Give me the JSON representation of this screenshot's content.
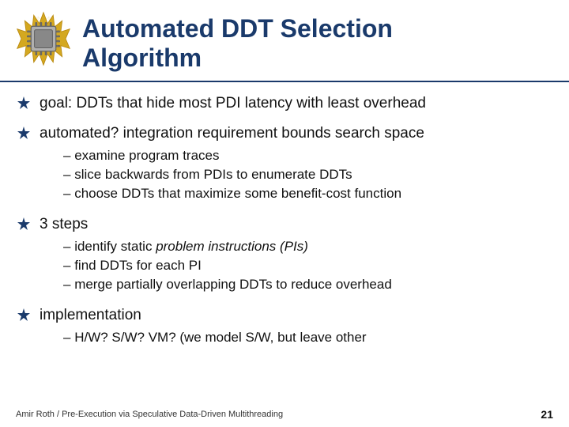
{
  "header": {
    "title_line1": "Automated DDT Selection",
    "title_line2": "Algorithm"
  },
  "bullets": [
    {
      "id": "bullet1",
      "text": "goal: DDTs that hide most PDI latency with least overhead",
      "sub_bullets": []
    },
    {
      "id": "bullet2",
      "text": "automated? integration requirement bounds search space",
      "sub_bullets": [
        "examine program traces",
        "slice backwards from PDIs to enumerate DDTs",
        "choose DDTs that maximize some benefit-cost function"
      ]
    },
    {
      "id": "bullet3",
      "text": "3 steps",
      "sub_bullets": [
        "identify static problem instructions (PIs)",
        "find DDTs for each PI",
        "merge partially overlapping DDTs to reduce overhead"
      ]
    },
    {
      "id": "bullet4",
      "text": "implementation",
      "sub_bullets": [
        "H/W? S/W? VM? (we model S/W, but leave other"
      ]
    }
  ],
  "footer": {
    "left_text": "Amir Roth / Pre-Execution via Speculative Data-Driven Multithreading",
    "page_number": "21"
  }
}
